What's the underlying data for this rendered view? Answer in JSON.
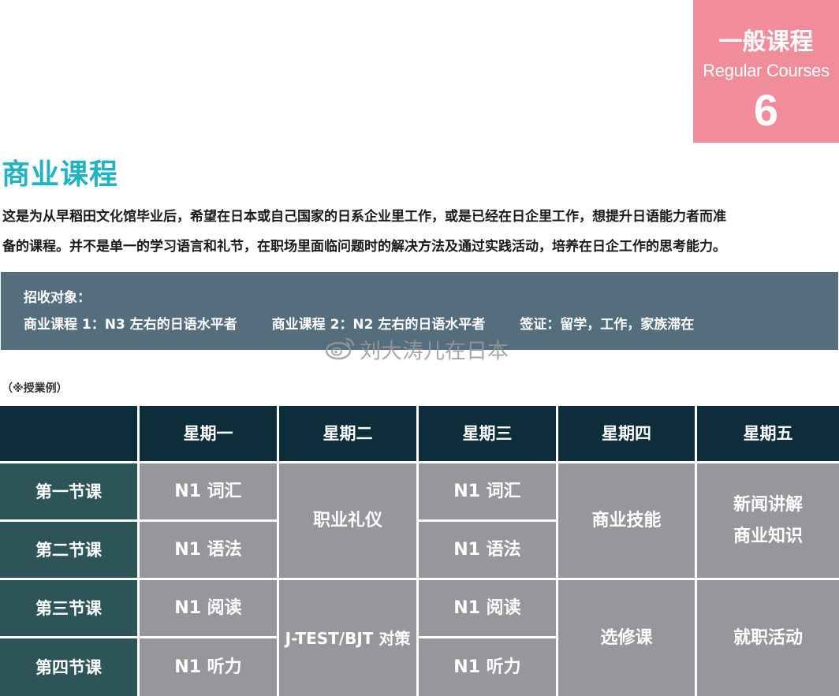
{
  "badge": {
    "title_zh": "一般课程",
    "title_en": "Regular Courses",
    "number": "6"
  },
  "section_title": "商业课程",
  "intro_lines": [
    "这是为从早稻田文化馆毕业后，希望在日本或自己国家的日系企业里工作，或是已经在日企里工作，想提升日语能力者而准",
    "备的课程。并不是单一的学习语言和礼节，在职场里面临问题时的解决方法及通过实践活动，培养在日企工作的思考能力。"
  ],
  "target": {
    "label": "招收对象：",
    "items": [
      "商业课程 1：N3 左右的日语水平者",
      "商业课程 2：N2 左右的日语水平者",
      "签证：留学，工作，家族滞在"
    ]
  },
  "watermark": "刘大涛儿在日本",
  "note": "（※授業例）",
  "schedule": {
    "days": [
      "星期一",
      "星期二",
      "星期三",
      "星期四",
      "星期五"
    ],
    "periods": [
      "第一节课",
      "第二节课",
      "第三节课",
      "第四节课"
    ],
    "mon": [
      "N1 词汇",
      "N1 语法",
      "N1 阅读",
      "N1 听力"
    ],
    "tue": [
      "职业礼仪",
      "J-TEST/BJT 对策"
    ],
    "wed": [
      "N1 词汇",
      "N1 语法",
      "N1 阅读",
      "N1 听力"
    ],
    "thu": [
      "商业技能",
      "选修课"
    ],
    "fri": [
      "新闻讲解",
      "商业知识",
      "就职活动"
    ]
  }
}
